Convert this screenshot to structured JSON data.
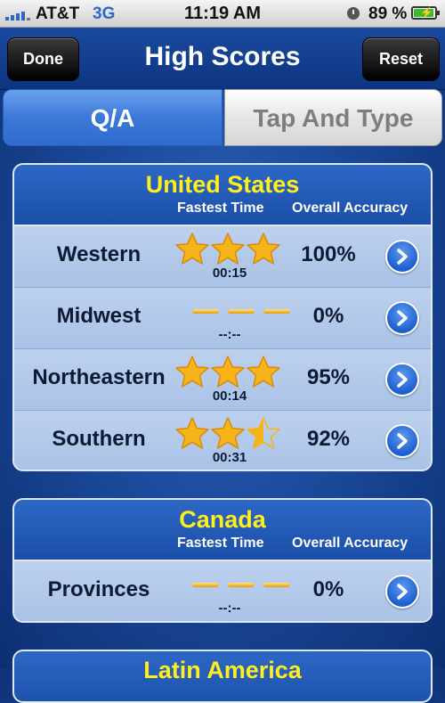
{
  "status_bar": {
    "carrier": "AT&T",
    "network": "3G",
    "time": "11:19 AM",
    "battery": "89 %"
  },
  "nav": {
    "title": "High Scores",
    "done_label": "Done",
    "reset_label": "Reset"
  },
  "tabs": {
    "active": "Q/A",
    "inactive": "Tap And Type"
  },
  "columns": {
    "fastest": "Fastest Time",
    "accuracy": "Overall Accuracy"
  },
  "sections": [
    {
      "title": "United States",
      "rows": [
        {
          "name": "Western",
          "stars": 3,
          "time": "00:15",
          "accuracy": "100%"
        },
        {
          "name": "Midwest",
          "stars": 0,
          "time": "--:--",
          "accuracy": "0%"
        },
        {
          "name": "Northeastern",
          "stars": 3,
          "time": "00:14",
          "accuracy": "95%"
        },
        {
          "name": "Southern",
          "stars": 2.5,
          "time": "00:31",
          "accuracy": "92%"
        }
      ]
    },
    {
      "title": "Canada",
      "rows": [
        {
          "name": "Provinces",
          "stars": 0,
          "time": "--:--",
          "accuracy": "0%"
        }
      ]
    },
    {
      "title": "Latin America"
    }
  ],
  "colors": {
    "section_title": "#ffef1a",
    "star": "#f7b418",
    "link_blue": "#2c66c9"
  }
}
